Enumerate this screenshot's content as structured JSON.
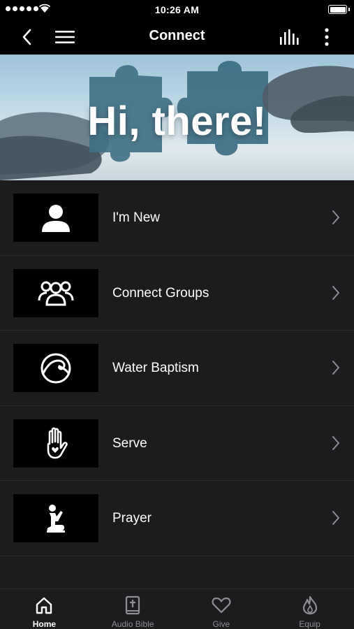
{
  "status_bar": {
    "time": "10:26 AM"
  },
  "nav": {
    "title": "Connect"
  },
  "hero": {
    "heading": "Hi, there!"
  },
  "menu": {
    "items": [
      {
        "label": "I'm New",
        "icon": "person-icon"
      },
      {
        "label": "Connect Groups",
        "icon": "group-icon"
      },
      {
        "label": "Water Baptism",
        "icon": "wave-icon"
      },
      {
        "label": "Serve",
        "icon": "hand-heart-icon"
      },
      {
        "label": "Prayer",
        "icon": "praying-person-icon"
      }
    ]
  },
  "tabs": [
    {
      "label": "Home",
      "icon": "home-icon",
      "active": true
    },
    {
      "label": "Audio Bible",
      "icon": "bible-icon",
      "active": false
    },
    {
      "label": "Give",
      "icon": "heart-icon",
      "active": false
    },
    {
      "label": "Equip",
      "icon": "flame-icon",
      "active": false
    }
  ],
  "colors": {
    "background": "#1c1c1e",
    "bar": "#000000",
    "text": "#ffffff",
    "muted": "#8e8e93"
  }
}
